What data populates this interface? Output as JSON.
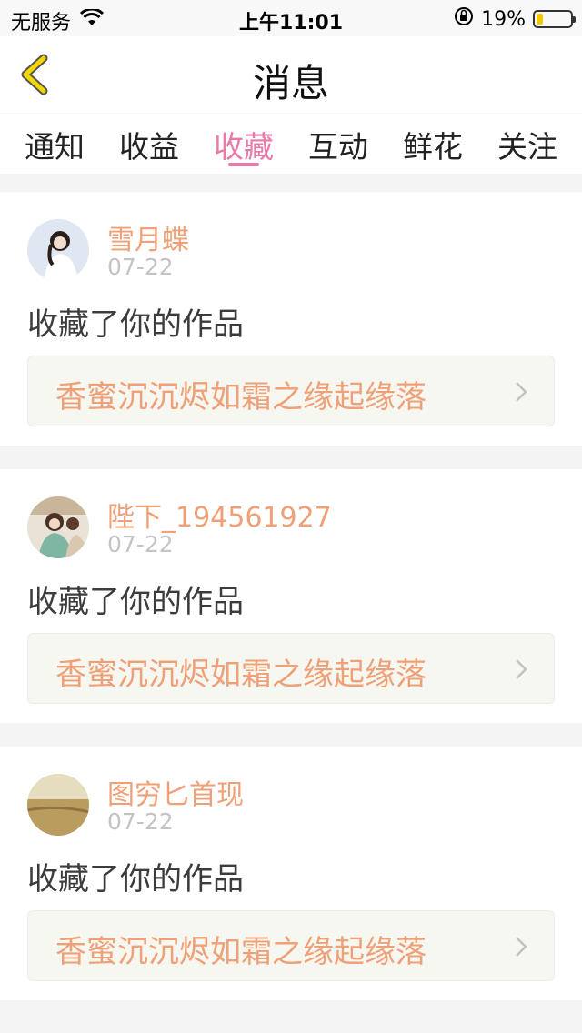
{
  "status_bar": {
    "carrier": "无服务",
    "time": "上午11:01",
    "battery": "19%",
    "battery_level": 0.19
  },
  "nav": {
    "title": "消息"
  },
  "tabs": [
    {
      "label": "通知",
      "active": false
    },
    {
      "label": "收益",
      "active": false
    },
    {
      "label": "收藏",
      "active": true
    },
    {
      "label": "互动",
      "active": false
    },
    {
      "label": "鲜花",
      "active": false
    },
    {
      "label": "关注",
      "active": false
    }
  ],
  "items": [
    {
      "username": "雪月蝶",
      "date": "07-22",
      "action": "收藏了你的作品",
      "work_title": "香蜜沉沉烬如霜之缘起缘落"
    },
    {
      "username": "陛下_194561927",
      "date": "07-22",
      "action": "收藏了你的作品",
      "work_title": "香蜜沉沉烬如霜之缘起缘落"
    },
    {
      "username": "图穷匕首现",
      "date": "07-22",
      "action": "收藏了你的作品",
      "work_title": "香蜜沉沉烬如霜之缘起缘落"
    }
  ],
  "colors": {
    "accent_pink": "#e879a8",
    "username_orange": "#f0a076",
    "back_arrow_yellow": "#f2d700"
  }
}
